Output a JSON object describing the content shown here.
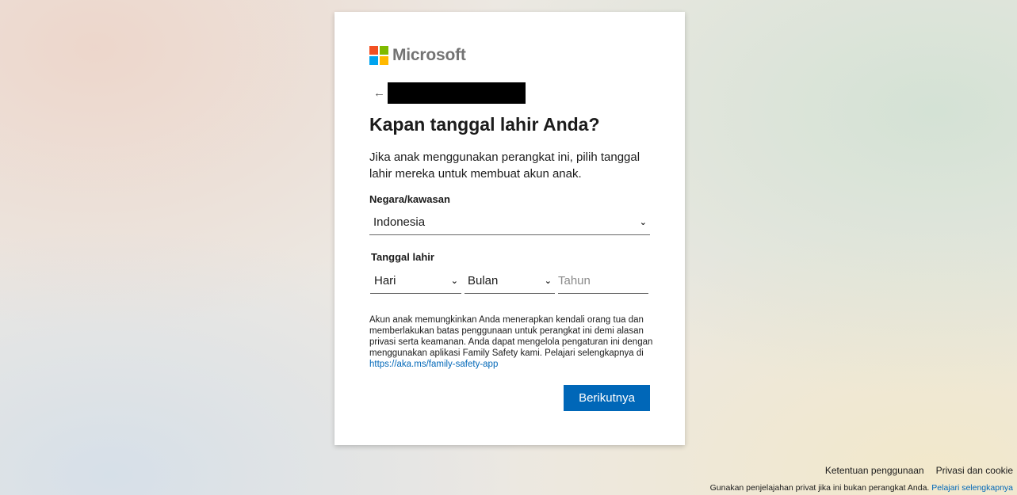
{
  "brand": {
    "name": "Microsoft",
    "logo_colors": [
      "#f25022",
      "#7fba00",
      "#00a4ef",
      "#ffb900"
    ]
  },
  "header": {
    "back_icon": "arrow-left-icon",
    "back_glyph": "←"
  },
  "page": {
    "title": "Kapan tanggal lahir Anda?",
    "description": "Jika anak menggunakan perangkat ini, pilih tanggal lahir mereka untuk membuat akun anak."
  },
  "country": {
    "label": "Negara/kawasan",
    "value": "Indonesia",
    "chevron": "⌄"
  },
  "birthdate": {
    "label": "Tanggal lahir",
    "day_value": "Hari",
    "month_value": "Bulan",
    "year_placeholder": "Tahun",
    "chevron": "⌄"
  },
  "info": {
    "text": "Akun anak memungkinkan Anda menerapkan kendali orang tua dan memberlakukan batas penggunaan untuk perangkat ini demi alasan privasi serta keamanan. Anda dapat mengelola pengaturan ini dengan menggunakan aplikasi Family Safety kami. Pelajari selengkapnya di ",
    "link": "https://aka.ms/family-safety-app"
  },
  "actions": {
    "next_label": "Berikutnya"
  },
  "footer": {
    "terms": "Ketentuan penggunaan",
    "privacy": "Privasi dan cookie",
    "note": "Gunakan penjelajahan privat jika ini bukan perangkat Anda.",
    "note_link": "Pelajari selengkapnya"
  },
  "colors": {
    "accent": "#0067b8",
    "card_bg": "#ffffff",
    "text": "#1b1b1b"
  }
}
